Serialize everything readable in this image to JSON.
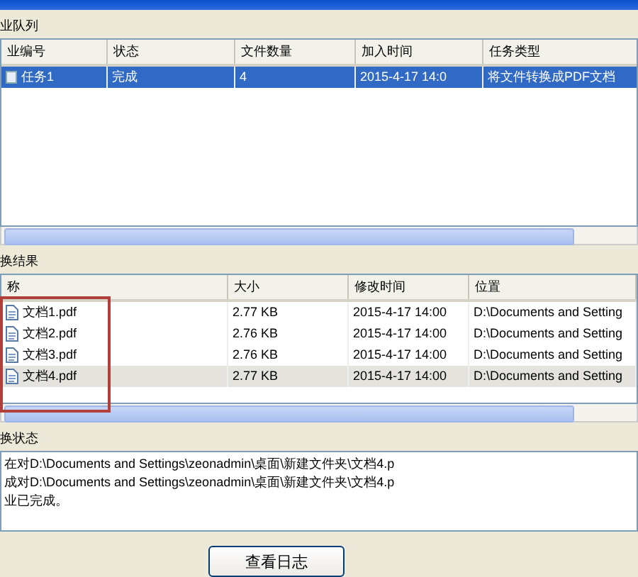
{
  "queue": {
    "title": "业队列",
    "list": {
      "focused": true,
      "columns": [
        "业编号",
        "状态",
        "文件数量",
        "加入时间",
        "任务类型"
      ],
      "rows": [
        {
          "selected": true,
          "cells": [
            "任务1",
            "完成",
            "4",
            "2015-4-17 14:0",
            "将文件转换成PDF文档"
          ]
        }
      ]
    }
  },
  "results": {
    "title": "换结果",
    "list": {
      "focused": false,
      "columns": [
        "称",
        "大小",
        "修改时间",
        "位置"
      ],
      "rows": [
        {
          "selected": false,
          "cells": [
            "文档1.pdf",
            "2.77 KB",
            "2015-4-17 14:00",
            "D:\\Documents and Setting"
          ]
        },
        {
          "selected": false,
          "cells": [
            "文档2.pdf",
            "2.76 KB",
            "2015-4-17 14:00",
            "D:\\Documents and Setting"
          ]
        },
        {
          "selected": false,
          "cells": [
            "文档3.pdf",
            "2.76 KB",
            "2015-4-17 14:00",
            "D:\\Documents and Setting"
          ]
        },
        {
          "selected": true,
          "cells": [
            "文档4.pdf",
            "2.77 KB",
            "2015-4-17 14:00",
            "D:\\Documents and Setting"
          ]
        }
      ]
    }
  },
  "status": {
    "title": "换状态",
    "lines": [
      "在对D:\\Documents and Settings\\zeonadmin\\桌面\\新建文件夹\\文档4.p",
      "成对D:\\Documents and Settings\\zeonadmin\\桌面\\新建文件夹\\文档4.p",
      "业已完成。"
    ]
  },
  "buttons": [
    "查看日志"
  ]
}
